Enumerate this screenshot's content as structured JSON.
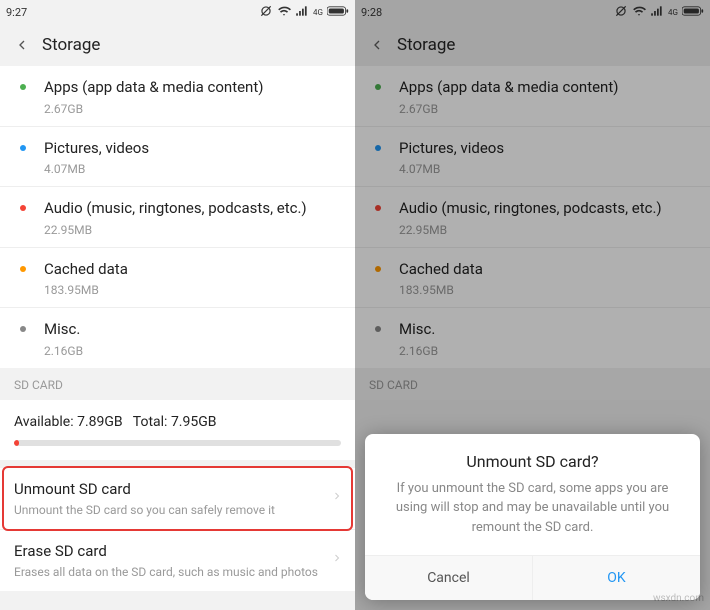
{
  "left": {
    "status": {
      "time": "9:27"
    },
    "header": {
      "title": "Storage"
    },
    "items": [
      {
        "title": "Apps (app data & media content)",
        "size": "2.67GB",
        "dot": "green"
      },
      {
        "title": "Pictures, videos",
        "size": "4.07MB",
        "dot": "blue"
      },
      {
        "title": "Audio (music, ringtones, podcasts, etc.)",
        "size": "22.95MB",
        "dot": "red"
      },
      {
        "title": "Cached data",
        "size": "183.95MB",
        "dot": "orange"
      },
      {
        "title": "Misc.",
        "size": "2.16GB",
        "dot": "gray"
      }
    ],
    "sd": {
      "section_label": "SD CARD",
      "available_label": "Available:",
      "available_value": "7.89GB",
      "total_label": "Total:",
      "total_value": "7.95GB",
      "unmount_title": "Unmount SD card",
      "unmount_desc": "Unmount the SD card so you can safely remove it",
      "erase_title": "Erase SD card",
      "erase_desc": "Erases all data on the SD card, such as music and photos"
    }
  },
  "right": {
    "status": {
      "time": "9:28"
    },
    "header": {
      "title": "Storage"
    },
    "items": [
      {
        "title": "Apps (app data & media content)",
        "size": "2.67GB",
        "dot": "green"
      },
      {
        "title": "Pictures, videos",
        "size": "4.07MB",
        "dot": "blue"
      },
      {
        "title": "Audio (music, ringtones, podcasts, etc.)",
        "size": "22.95MB",
        "dot": "red"
      },
      {
        "title": "Cached data",
        "size": "183.95MB",
        "dot": "orange"
      },
      {
        "title": "Misc.",
        "size": "2.16GB",
        "dot": "gray"
      }
    ],
    "sd": {
      "section_label": "SD CARD"
    },
    "dialog": {
      "title": "Unmount SD card?",
      "body": "If you unmount the SD card, some apps you are using will stop and may be unavailable until you remount the SD card.",
      "cancel": "Cancel",
      "ok": "OK"
    }
  },
  "watermark": "wsxdn.com"
}
